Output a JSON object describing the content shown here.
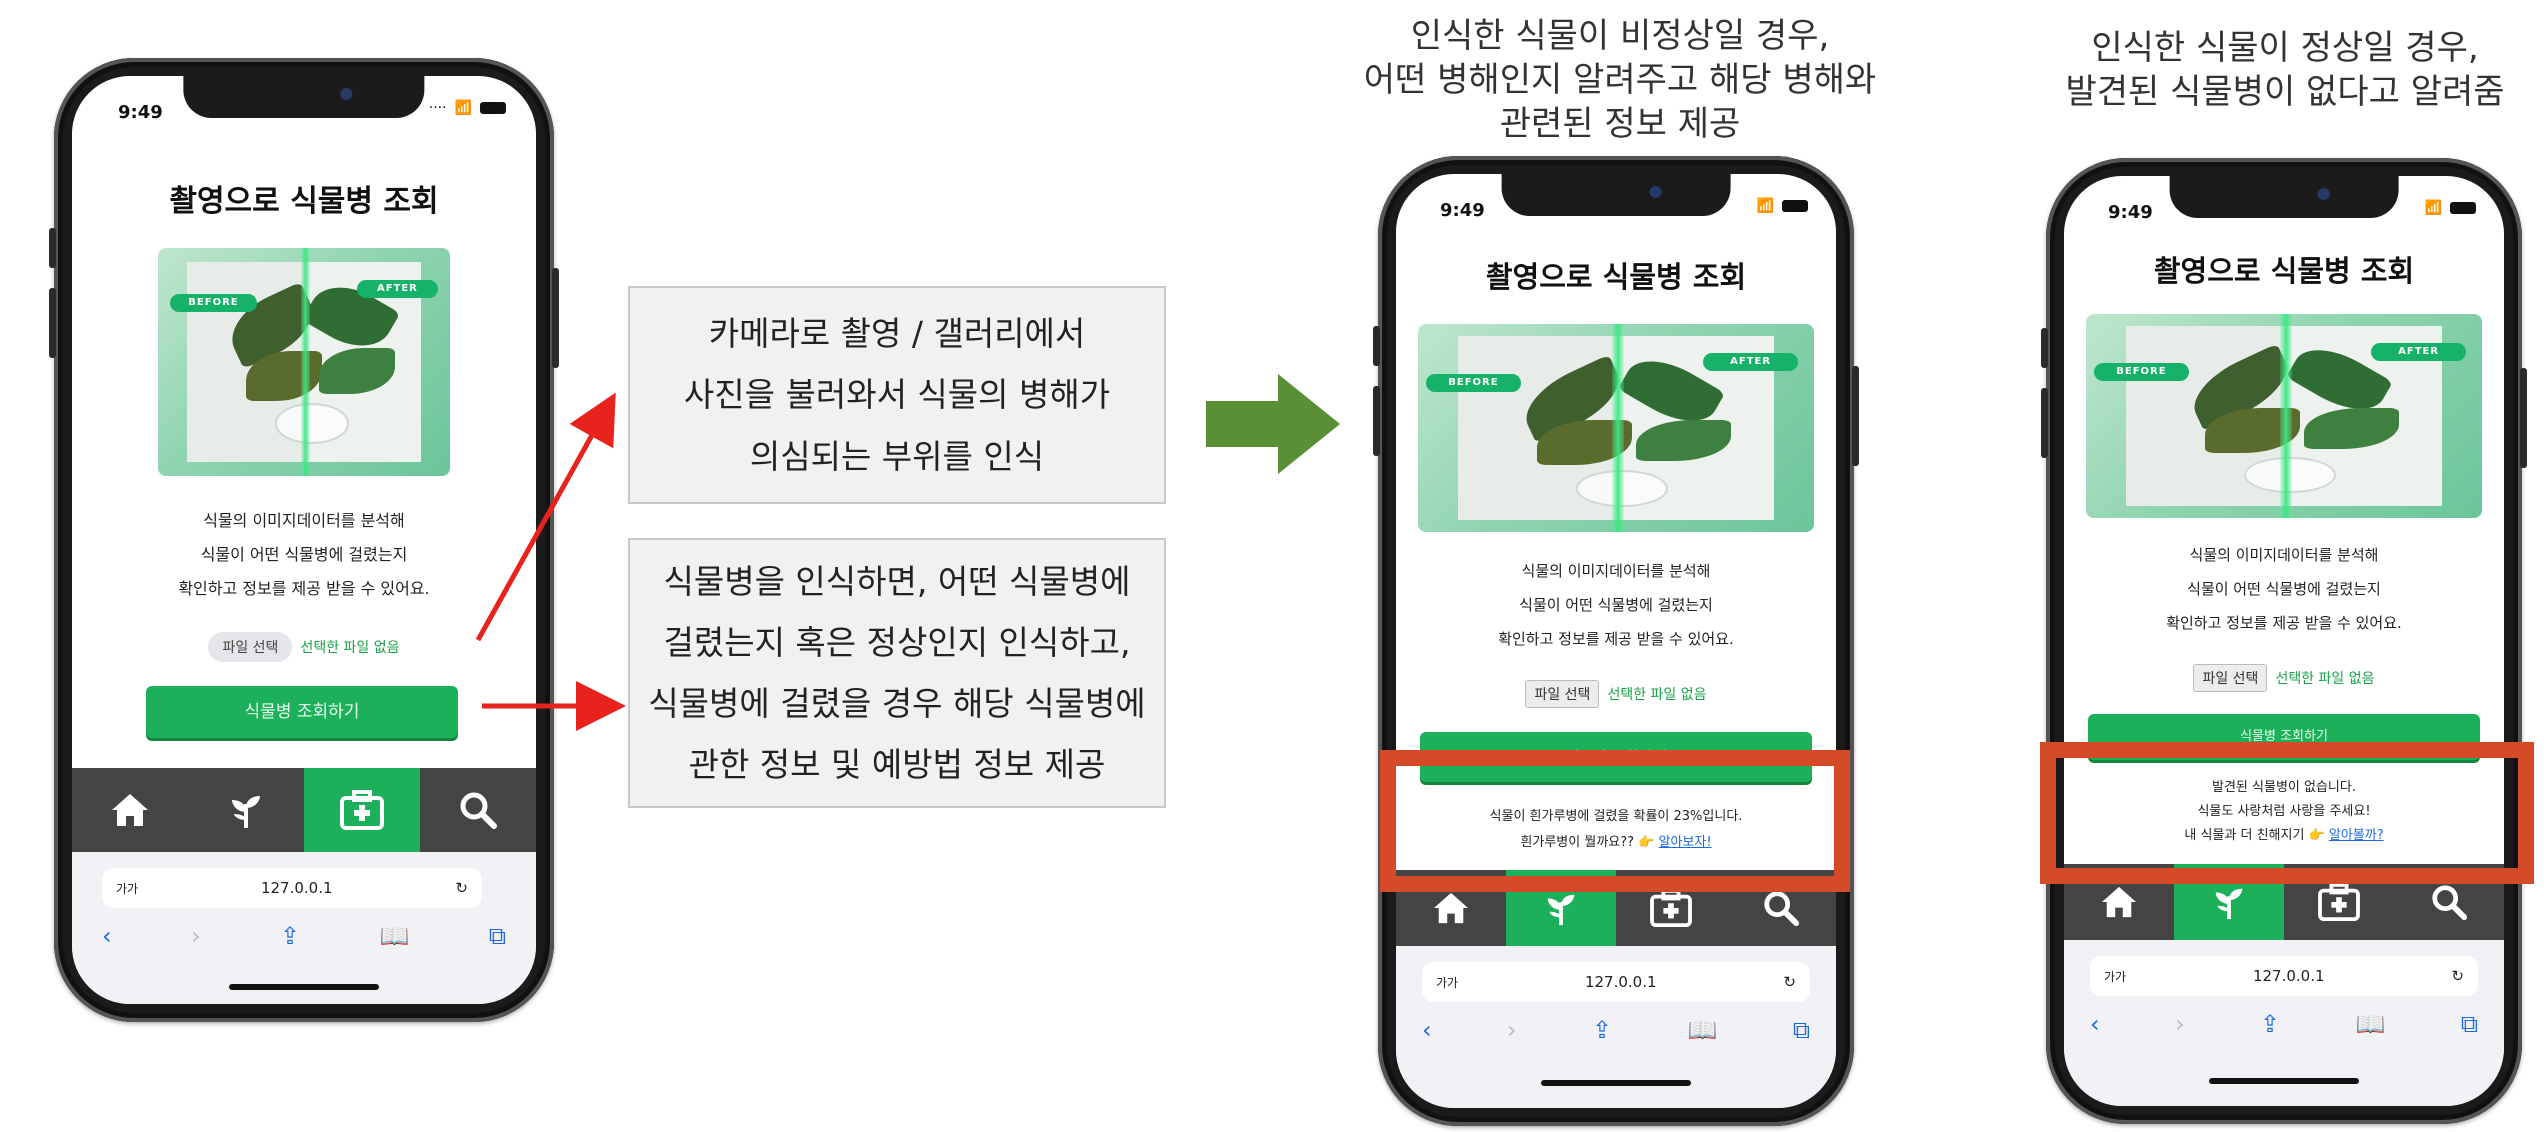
{
  "status_time": "9:49",
  "app_title": "촬영으로 식물병 조회",
  "hero": {
    "before_tag": "BEFORE",
    "after_tag": "AFTER"
  },
  "description_lines": [
    "식물의 이미지데이터를 분석해",
    "식물이 어떤 식물병에 걸렸는지",
    "확인하고 정보를 제공 받을 수 있어요."
  ],
  "file_button_label": "파일 선택",
  "file_status": "선택한 파일 없음",
  "search_button_label": "식물병 조회하기",
  "safari": {
    "text_size_label": "가가",
    "url": "127.0.0.1"
  },
  "tabs": [
    {
      "name": "home",
      "icon": "home-icon"
    },
    {
      "name": "plant",
      "icon": "sprout-icon"
    },
    {
      "name": "diagnose",
      "icon": "medical-kit-icon"
    },
    {
      "name": "search",
      "icon": "search-icon"
    }
  ],
  "info_boxes": [
    {
      "lines": [
        "카메라로 촬영 / 갤러리에서",
        "사진을 불러와서 식물의 병해가",
        "의심되는 부위를 인식"
      ]
    },
    {
      "lines": [
        "식물병을 인식하면, 어떤 식물병에",
        "걸렸는지 혹은 정상인지 인식하고,",
        "식물병에 걸렸을 경우 해당 식물병에",
        "관한 정보 및 예방법 정보 제공"
      ]
    }
  ],
  "captions": {
    "abnormal": [
      "인식한 식물이 비정상일 경우,",
      "어떤 병해인지 알려주고 해당 병해와",
      "관련된 정보 제공"
    ],
    "normal": [
      "인식한 식물이 정상일 경우,",
      "발견된 식물병이 없다고 알려줌"
    ]
  },
  "results": {
    "abnormal": {
      "line1": "식물이 흰가루병에 걸렸을 확률이 23%입니다.",
      "line2": "흰가루병이 뭘까요?? 👉",
      "link": "알아보자!"
    },
    "normal": {
      "line1": "발견된 식물병이 없습니다.",
      "line2": "식물도 사랑처럼 사랑을 주세요!",
      "line3": "내 식물과 더 친해지기 👉",
      "link": "알아볼까?"
    }
  },
  "colors": {
    "accent": "#1db05a",
    "highlight_box": "#d54a27",
    "arrow_red": "#e8231d",
    "arrow_green": "#5a8f35",
    "tabbar": "#444444"
  }
}
